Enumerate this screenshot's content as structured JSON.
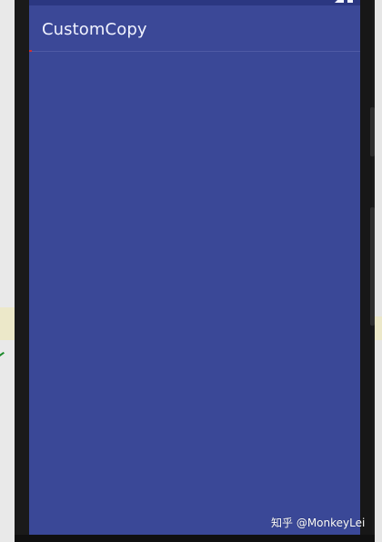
{
  "app": {
    "title": "CustomCopy"
  },
  "status_bar": {
    "icons": [
      "signal-icon",
      "battery-icon"
    ]
  },
  "watermark": {
    "text": "知乎 @MonkeyLei"
  },
  "colors": {
    "app_bar": "#3b4897",
    "status_bar": "#2b3781",
    "content_background": "#3a4897",
    "title_text": "#f1f3ff",
    "phone_frame": "#1a1a1a"
  }
}
